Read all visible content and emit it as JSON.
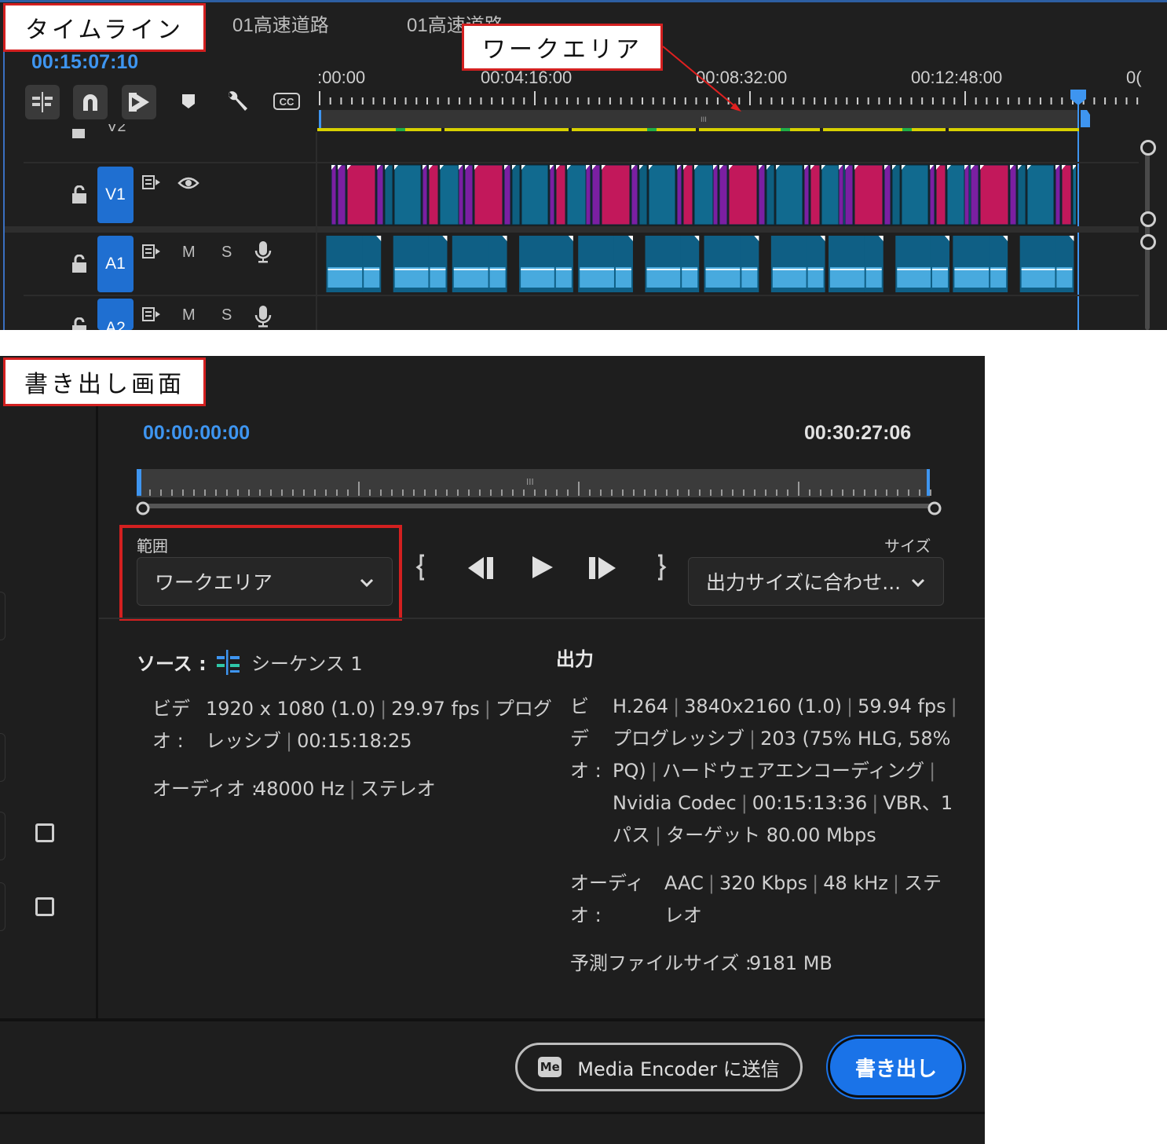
{
  "timeline_panel": {
    "callout_label": "タイムライン",
    "workarea_callout": "ワークエリア",
    "tabs": [
      "01高速道路",
      "01高速道路"
    ],
    "current_timecode": "00:15:07:10",
    "ruler": {
      "labels": [
        ":00:00",
        "00:04:16:00",
        "00:08:32:00",
        "00:12:48:00",
        "0("
      ]
    },
    "tracks": {
      "v2": "V2",
      "v1": "V1",
      "a1": "A1",
      "a2": "A2",
      "mute": "M",
      "solo": "S"
    },
    "tool_icons": [
      "insert-icon",
      "snap-icon",
      "linked-selection-icon",
      "marker-icon",
      "wrench-icon",
      "captions-icon"
    ]
  },
  "export_panel": {
    "callout_label": "書き出し画面",
    "start_timecode": "00:00:00:00",
    "end_timecode": "00:30:27:06",
    "range": {
      "label": "範囲",
      "value": "ワークエリア"
    },
    "size": {
      "label": "サイズ",
      "value": "出力サイズに合わせ..."
    },
    "source": {
      "label": "ソース :",
      "name": "シーケンス 1",
      "video_label_1": "ビデ",
      "video_label_2": "オ :",
      "video_line_1": [
        "1920 x 1080 (1.0)",
        "29.97 fps",
        "プログ"
      ],
      "video_line_2": [
        "レッシブ",
        "00:15:18:25"
      ],
      "audio_label": "オーディオ :",
      "audio_value": [
        "48000 Hz",
        "ステレオ"
      ]
    },
    "output": {
      "label": "出力",
      "video_label": [
        "ビ",
        "デ",
        "オ :"
      ],
      "video_lines": [
        [
          "H.264",
          "3840x2160 (1.0)",
          "59.94 fps",
          ""
        ],
        [
          "プログレッシブ",
          "203 (75% HLG, 58%"
        ],
        [
          "PQ)",
          "ハードウェアエンコーディング",
          ""
        ],
        [
          "Nvidia Codec",
          "00:15:13:36",
          "VBR、1"
        ],
        [
          "パス",
          "ターゲット 80.00 Mbps"
        ]
      ],
      "audio_label": [
        "オーディ",
        "オ :"
      ],
      "audio_lines": [
        [
          "AAC",
          "320 Kbps",
          "48 kHz",
          "ステ"
        ],
        [
          "レオ"
        ]
      ],
      "filesize_label": "予測ファイルサイズ :",
      "filesize_value": "9181 MB"
    },
    "media_encoder_button": "Media Encoder に送信",
    "me_badge": "Me",
    "export_button": "書き出し",
    "colors": {
      "accent": "#1a73e8",
      "highlight_box": "#d32020"
    }
  }
}
